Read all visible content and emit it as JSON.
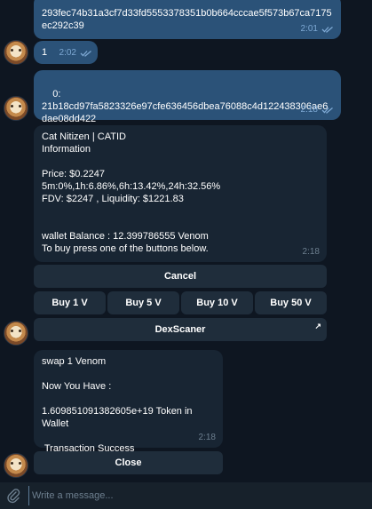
{
  "messages": {
    "hash_tail": {
      "text": "293fec74b31a3cf7d33fd5553378351b0b664cccae5f573b67ca7175ec292c39",
      "time": "2:01"
    },
    "one": {
      "text": "1",
      "time": "2:02"
    },
    "zero_hash": {
      "text": "0:\n21b18cd97fa5823326e97cfe636456dbea76088c4d122438306ae6dae08dd422",
      "time": "2:18"
    },
    "info": {
      "title": "Cat Nitizen | CATID",
      "subtitle": "Information",
      "price": "Price: $0.2247",
      "changes": "5m:0%,1h:6.86%,6h:13.42%,24h:32.56%",
      "fdv": "FDV: $2247 , Liquidity: $1221.83",
      "wallet": "wallet Balance : 12.399786555 Venom",
      "instruction": "To buy press one of the buttons below.",
      "time": "2:18"
    },
    "swap": {
      "line1": "swap 1 Venom",
      "line2": "Now You Have :",
      "line3": "1.609851091382605e+19 Token in Wallet",
      "line4": " Transaction Success",
      "time": "2:18"
    }
  },
  "buttons": {
    "cancel": "Cancel",
    "buy1": "Buy 1 V",
    "buy5": "Buy 5 V",
    "buy10": "Buy 10 V",
    "buy50": "Buy 50 V",
    "dexscaner": "DexScaner",
    "close": "Close"
  },
  "composer": {
    "placeholder": "Write a message..."
  },
  "colors": {
    "background": "#0e1621",
    "outgoing_bubble": "#2b5278",
    "incoming_bubble": "#182533",
    "inline_button": "#1f2d3b",
    "read_check": "#7da8d3"
  }
}
